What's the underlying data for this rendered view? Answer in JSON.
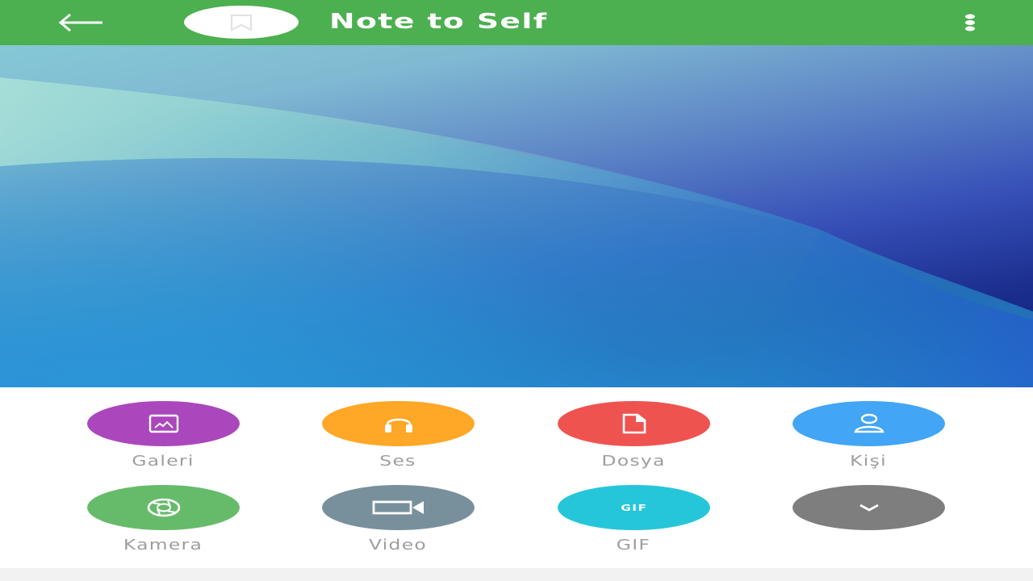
{
  "toolbar": {
    "title": "Note to Self",
    "color": "#4caf50",
    "back_icon": "arrow-left-icon",
    "avatar_icon": "bookmark-icon",
    "menu_icon": "more-vertical-icon"
  },
  "wallpaper": {
    "type": "abstract-blue-gradient"
  },
  "attachments": [
    {
      "label": "Galeri",
      "color": "#ab47bc",
      "icon": "image-icon"
    },
    {
      "label": "Ses",
      "color": "#ffa726",
      "icon": "headphones-icon"
    },
    {
      "label": "Dosya",
      "color": "#ef5350",
      "icon": "file-icon"
    },
    {
      "label": "Kişi",
      "color": "#42a5f5",
      "icon": "contact-icon"
    },
    {
      "label": "Kamera",
      "color": "#66bb6a",
      "icon": "camera-shutter-icon"
    },
    {
      "label": "Video",
      "color": "#78909c",
      "icon": "video-icon"
    },
    {
      "label": "GIF",
      "color": "#26c6da",
      "icon": "gif-icon",
      "icon_text": "GIF"
    },
    {
      "label": "",
      "color": "#7e7e7e",
      "icon": "chevron-down-icon"
    }
  ]
}
